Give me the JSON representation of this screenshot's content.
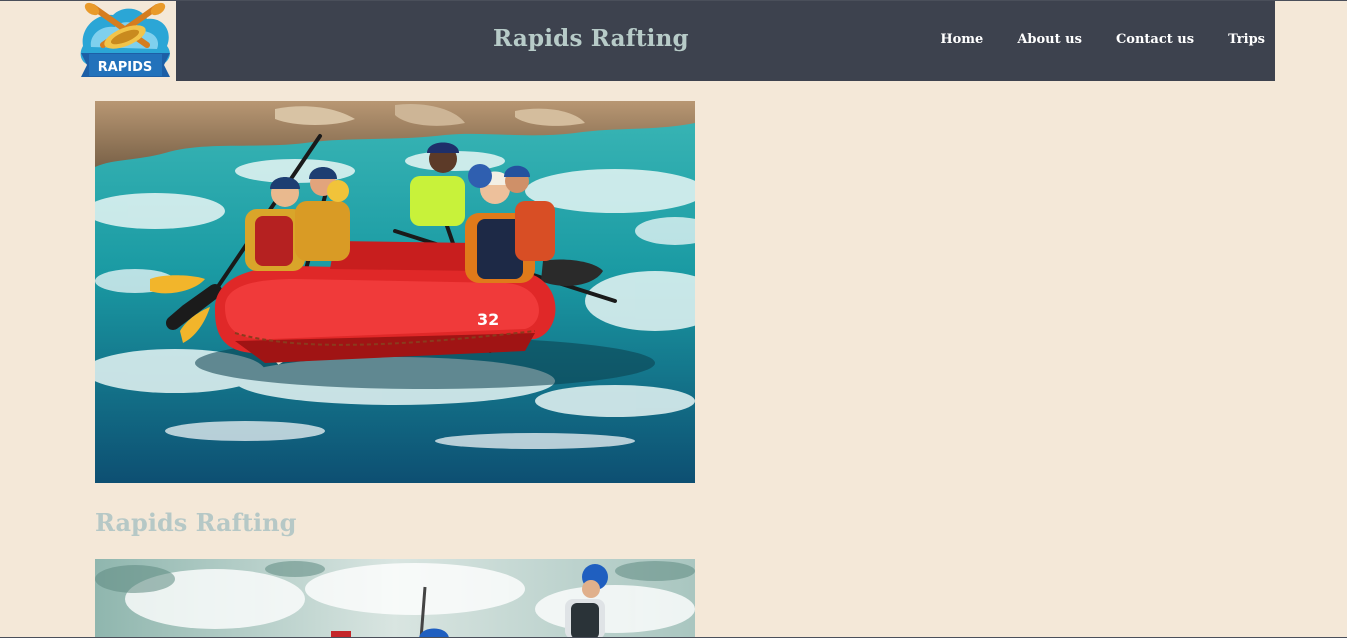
{
  "header": {
    "logo_text": "RAPIDS",
    "site_title": "Rapids Rafting",
    "nav": [
      {
        "label": "Home"
      },
      {
        "label": "About us"
      },
      {
        "label": "Contact us"
      },
      {
        "label": "Trips"
      }
    ]
  },
  "main": {
    "hero_image": {
      "raft_number": "32"
    },
    "section_heading": "Rapids Rafting"
  },
  "colors": {
    "page_background": "#f4e8d8",
    "header_background": "#3d424e",
    "title_color": "#b7cbc8",
    "nav_color": "#ffffff",
    "raft_red": "#e52b2b",
    "water_teal": "#1b9ea3"
  }
}
